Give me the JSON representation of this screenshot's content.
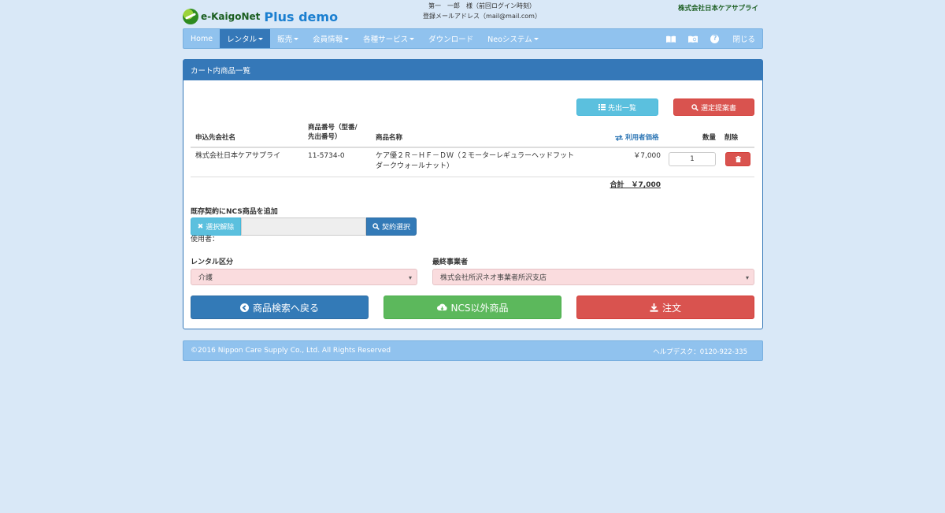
{
  "header": {
    "logo_text": "e-KaigoNet",
    "logo_plus": "Plus demo",
    "user_line1": "第一　一郎　様（前回ログイン時刻）",
    "user_line2": "登録メールアドレス（mail@mail.com）",
    "company": "株式会社日本ケアサプライ"
  },
  "nav": {
    "items": [
      {
        "label": "Home",
        "dropdown": false
      },
      {
        "label": "レンタル",
        "dropdown": true,
        "active": true
      },
      {
        "label": "販売",
        "dropdown": true
      },
      {
        "label": "会員情報",
        "dropdown": true
      },
      {
        "label": "各種サービス",
        "dropdown": true
      },
      {
        "label": "ダウンロード",
        "dropdown": false
      },
      {
        "label": "Neoシステム",
        "dropdown": true
      }
    ],
    "close_label": "閉じる",
    "help_glyph": "?",
    "book_glyph": "📖"
  },
  "panel": {
    "title": "カート内商品一覧",
    "buttons": {
      "list_label": "先出一覧",
      "proposal_label": "選定提案書"
    },
    "table": {
      "headers": {
        "company": "申込先会社名",
        "product_no": "商品番号（型番/先出番号）",
        "product_no_line1": "商品番号（型番/",
        "product_no_line2": "先出番号）",
        "product_name": "商品名称",
        "price": "利用者価格",
        "qty": "数量",
        "delete": "削除"
      },
      "rows": [
        {
          "company": "株式会社日本ケアサプライ",
          "product_no": "11-5734-0",
          "product_name_line1": "ケア優２Ｒ－ＨＦ－ＤＷ（２モーターレギュラーヘッドフット",
          "product_name_line2": "ダークウォールナット）",
          "price": "￥7,000",
          "qty": "1"
        }
      ],
      "total_label": "合計　￥7,000"
    },
    "ncs": {
      "section_label": "既存契約にNCS商品を追加",
      "clear_label": "選択解除",
      "input_value": "",
      "select_contract_label": "契約選択",
      "user_label": "使用者："
    },
    "rental_type": {
      "label": "レンタル区分",
      "value": "介護"
    },
    "final_operator": {
      "label": "最終事業者",
      "value": "株式会社所沢ネオ事業者所沢支店"
    },
    "actions": {
      "back_label": "商品検索へ戻る",
      "non_ncs_label": "NCS以外商品",
      "order_label": "注文"
    }
  },
  "footer": {
    "copyright": "©2016 Nippon Care Supply Co., Ltd. All Rights Reserved",
    "helpdesk": "ヘルプデスク：0120-922-335"
  },
  "colors": {
    "page_bg": "#d9e8f7",
    "navbar": "#90c2ee",
    "primary": "#337ab7",
    "info": "#5bc0de",
    "danger": "#d9534f",
    "success": "#5cb85c",
    "select_bg": "#fadcde"
  }
}
